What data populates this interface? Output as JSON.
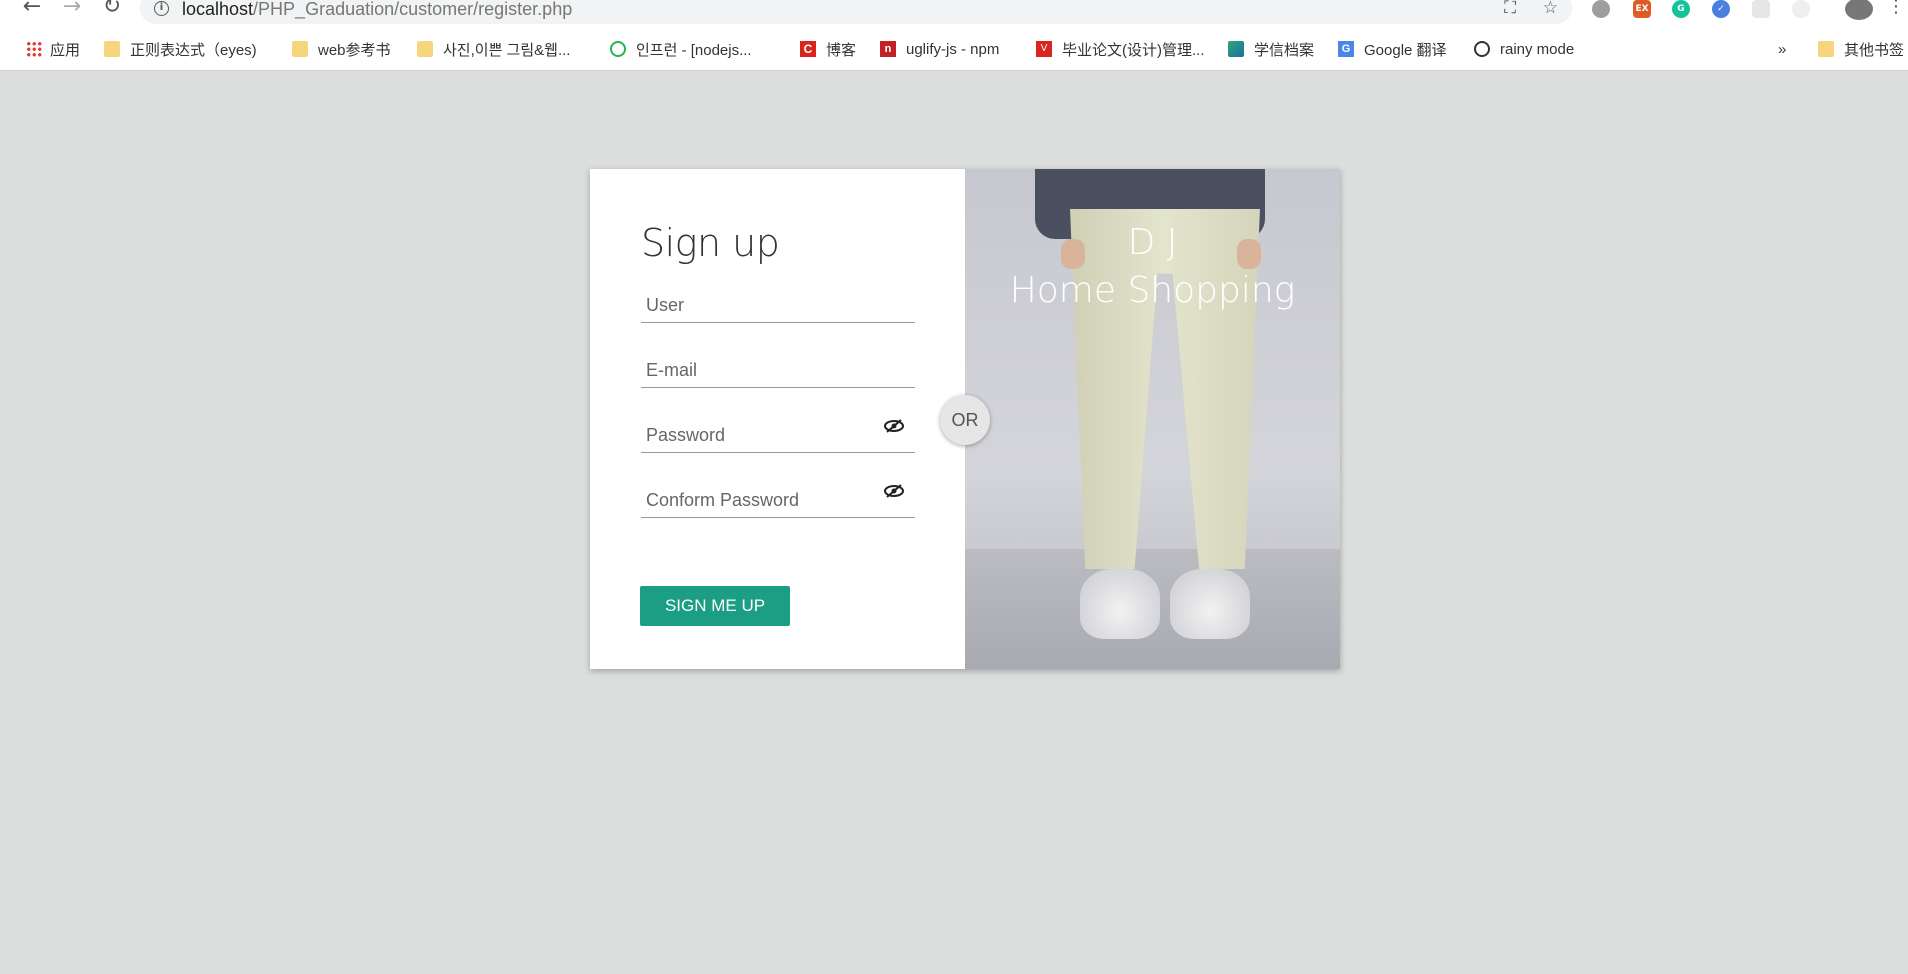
{
  "browser": {
    "url_host": "localhost",
    "url_path": "/PHP_Graduation/customer/register.php",
    "bookmarks": [
      {
        "label": "应用"
      },
      {
        "label": "正则表达式（eyes)"
      },
      {
        "label": "web参考书"
      },
      {
        "label": "사진,이쁜 그림&웹..."
      },
      {
        "label": "인프런 - [nodejs..."
      },
      {
        "label": "博客"
      },
      {
        "label": "uglify-js - npm"
      },
      {
        "label": "毕业论文(设计)管理..."
      },
      {
        "label": "学信档案"
      },
      {
        "label": "Google 翻译"
      },
      {
        "label": "rainy mode"
      },
      {
        "label": "»"
      },
      {
        "label": "其他书签"
      }
    ]
  },
  "form": {
    "title": "Sign up",
    "user_placeholder": "User",
    "email_placeholder": "E-mail",
    "password_placeholder": "Password",
    "confirm_placeholder": "Conform Password",
    "submit_label": "SIGN ME UP",
    "or_label": "OR"
  },
  "brand": {
    "line1": "D J",
    "line2": "Home Shopping"
  },
  "colors": {
    "accent": "#1b9e83",
    "page_bg": "#dcdedd"
  }
}
